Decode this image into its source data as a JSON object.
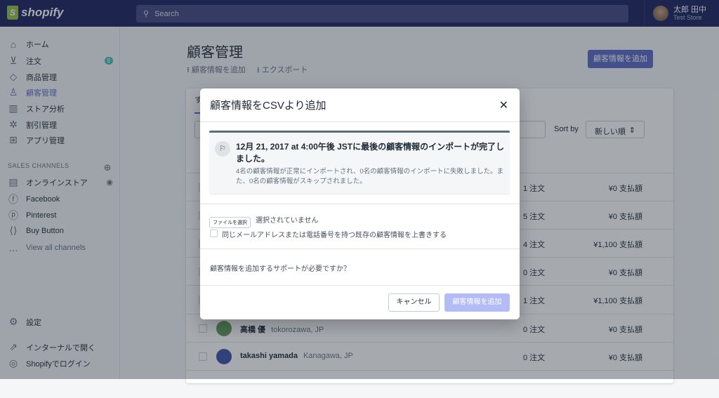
{
  "topbar": {
    "brand": "shopify",
    "search_placeholder": "Search",
    "user_name": "太郎 田中",
    "store": "Test Store"
  },
  "sidebar": {
    "items": [
      {
        "label": "ホーム",
        "icon": "home-icon"
      },
      {
        "label": "注文",
        "icon": "orders-icon",
        "badge": "9"
      },
      {
        "label": "商品管理",
        "icon": "tag-icon"
      },
      {
        "label": "顧客管理",
        "icon": "customer-icon",
        "active": true
      },
      {
        "label": "ストア分析",
        "icon": "analytics-icon"
      },
      {
        "label": "割引管理",
        "icon": "discount-icon"
      },
      {
        "label": "アプリ管理",
        "icon": "apps-icon"
      }
    ],
    "sales_channels_title": "SALES CHANNELS",
    "channels": [
      {
        "label": "オンラインストア",
        "icon": "store-icon"
      },
      {
        "label": "Facebook",
        "icon": "facebook-icon"
      },
      {
        "label": "Pinterest",
        "icon": "pinterest-icon"
      },
      {
        "label": "Buy Button",
        "icon": "code-icon"
      }
    ],
    "view_all": "View all channels",
    "settings": "設定",
    "open_internal": "インターナルで開く",
    "login": "Shopifyでログイン"
  },
  "page": {
    "title": "顧客管理",
    "import": "顧客情報を追加",
    "export": "エクスポート",
    "add_button": "顧客情報を追加",
    "tab": "す",
    "sort_label": "Sort by",
    "sort_value": "新しい順"
  },
  "rows": [
    {
      "name": "",
      "location": "",
      "orders": "1 注文",
      "amount": "¥0 支払額"
    },
    {
      "name": "",
      "location": "",
      "orders": "5 注文",
      "amount": "¥0 支払額"
    },
    {
      "name": "",
      "location": "",
      "orders": "4 注文",
      "amount": "¥1,100 支払額"
    },
    {
      "name": "",
      "location": "",
      "orders": "0 注文",
      "amount": "¥0 支払額"
    },
    {
      "name": "",
      "location": "",
      "orders": "1 注文",
      "amount": "¥1,100 支払額"
    },
    {
      "name": "高橋 優",
      "location": "tokorozawa, JP",
      "orders": "0 注文",
      "amount": "¥0 支払額",
      "avatar": "#5f9a5a"
    },
    {
      "name": "takashi yamada",
      "location": "Kanagawa, JP",
      "orders": "0 注文",
      "amount": "¥0 支払額",
      "avatar": "#3f51a6"
    }
  ],
  "modal": {
    "title": "顧客情報をCSVより追加",
    "banner_title": "12月 21, 2017 at 4:00午後 JSTに最後の顧客情報のインポートが完了しました。",
    "banner_body": "4名の顧客情報が正常にインポートされ、0名の顧客情報のインポートに失敗しました。また、0名の顧客情報がスキップされました。",
    "file_button": "ファイルを選択",
    "no_file": "選択されていません",
    "overwrite_label": "同じメールアドレスまたは電話番号を持つ既存の顧客情報を上書きする",
    "help": "顧客情報を追加するサポートが必要ですか？",
    "cancel": "キャンセル",
    "submit": "顧客情報を追加"
  },
  "colors": {
    "topbar": "#1c2260",
    "accent": "#5c6ac4",
    "badge": "#47c1bf"
  }
}
